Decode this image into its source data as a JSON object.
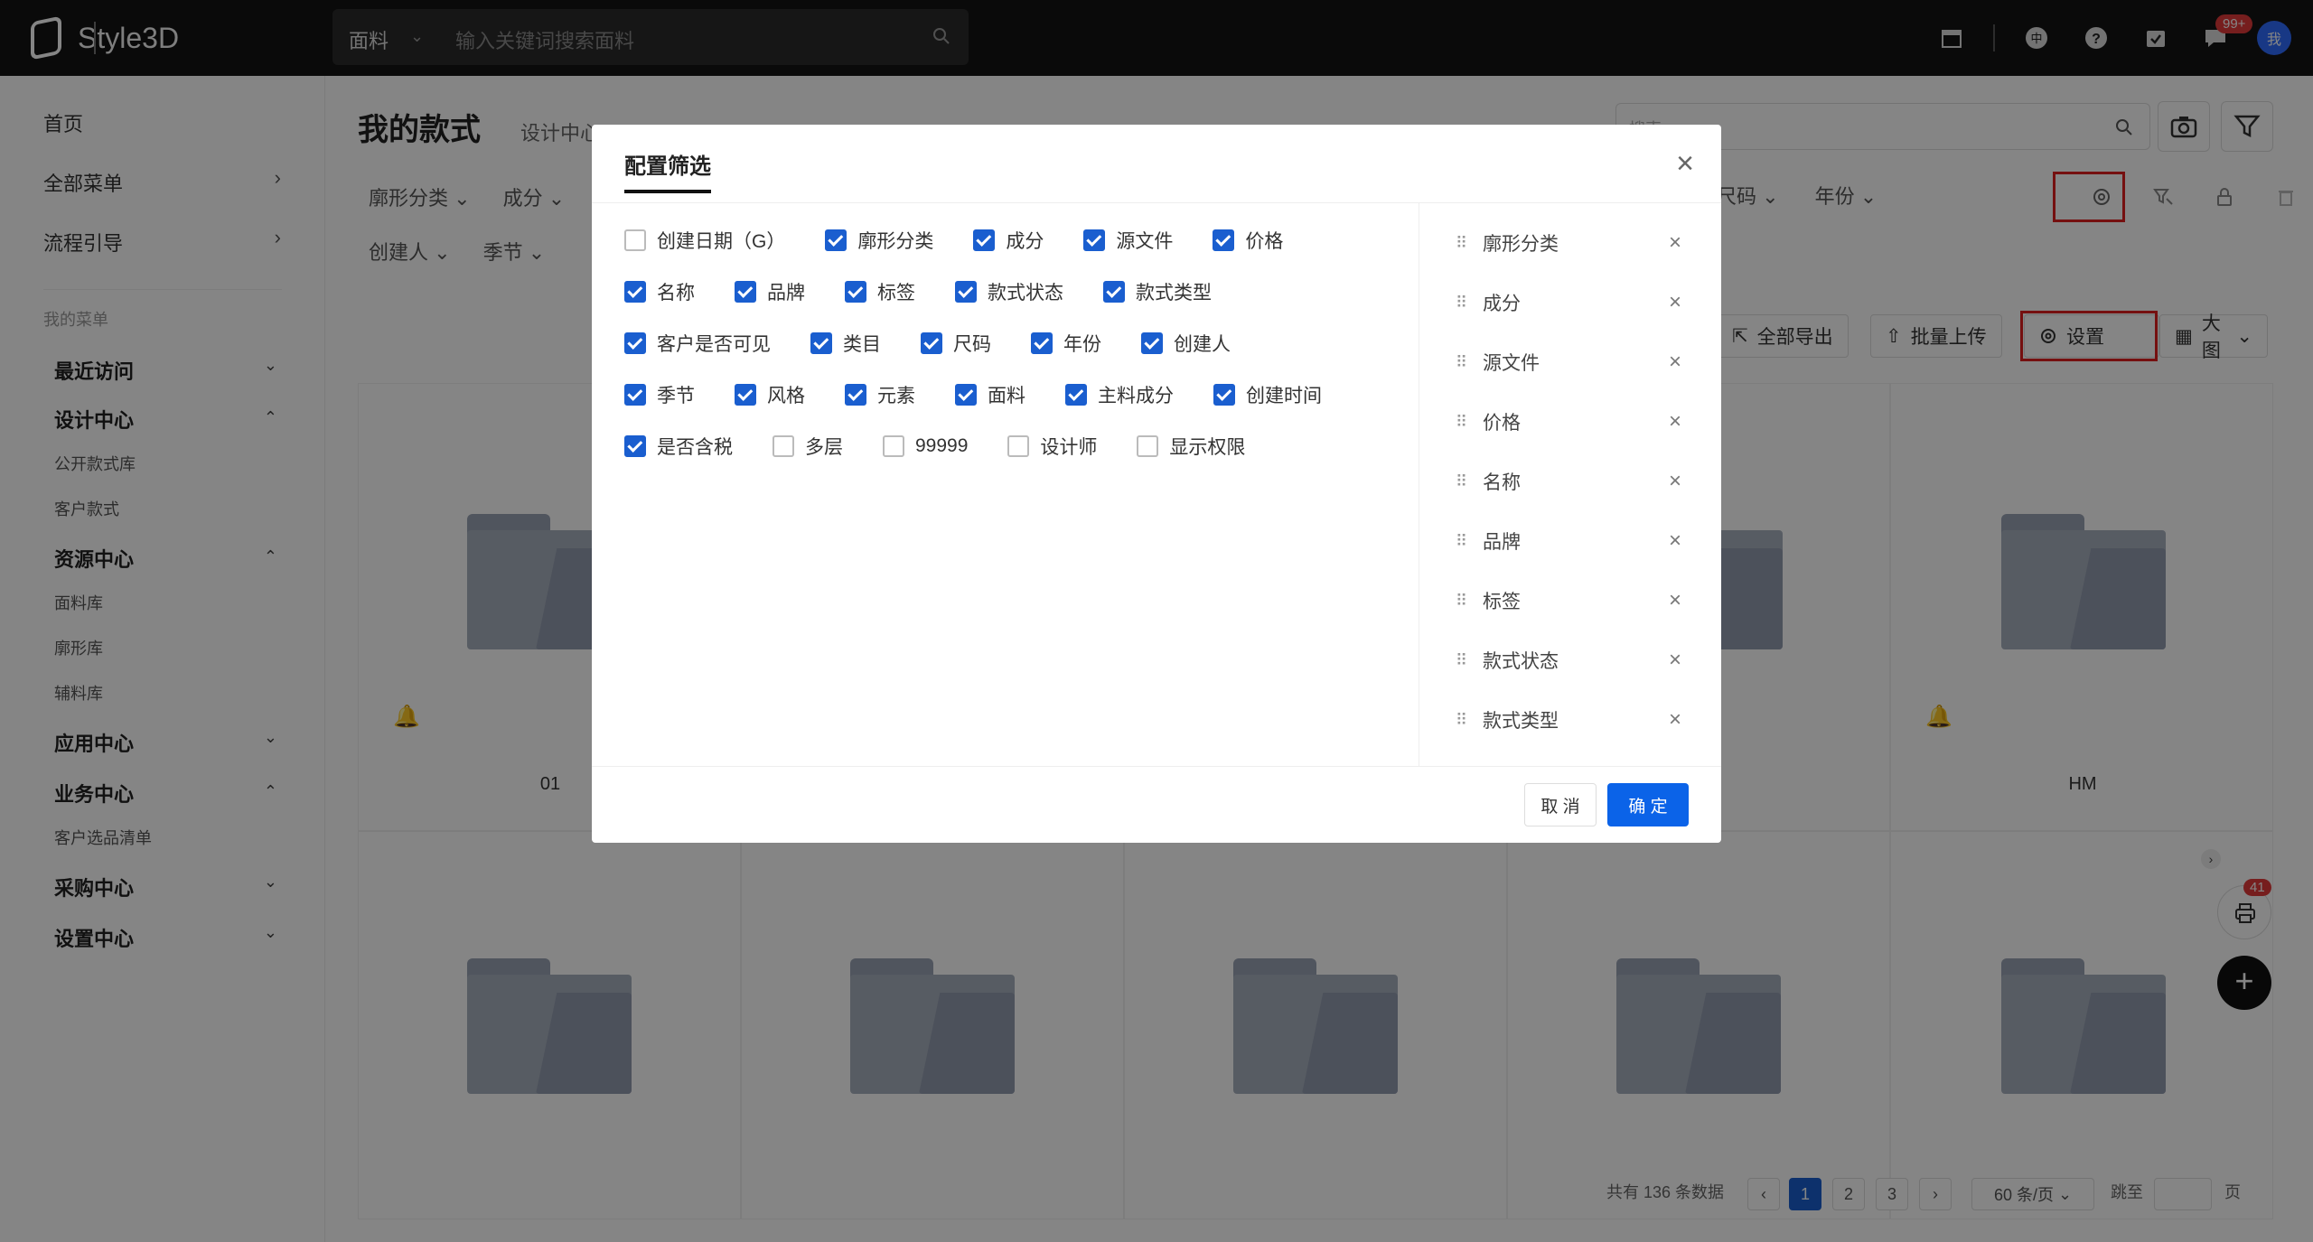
{
  "app": {
    "name": "Style3D"
  },
  "topbar": {
    "search_category": "面料",
    "search_placeholder": "输入关键词搜索面料",
    "message_badge": "99+",
    "avatar_text": "我"
  },
  "sidebar": {
    "top_items": [
      {
        "label": "首页"
      },
      {
        "label": "全部菜单"
      },
      {
        "label": "流程引导"
      }
    ],
    "caption": "我的菜单",
    "groups": [
      {
        "label": "最近访问"
      },
      {
        "label": "设计中心",
        "children": [
          "公开款式库",
          "客户款式"
        ]
      },
      {
        "label": "资源中心",
        "children": [
          "面料库",
          "廓形库",
          "辅料库"
        ]
      },
      {
        "label": "应用中心"
      },
      {
        "label": "业务中心",
        "children": [
          "客户选品清单"
        ]
      },
      {
        "label": "采购中心"
      },
      {
        "label": "设置中心"
      }
    ]
  },
  "main": {
    "title": "我的款式",
    "breadcrumb": "设计中心",
    "filters_row1": [
      "廓形分类",
      "成分"
    ],
    "filters_row2": [
      "创建人",
      "季节"
    ],
    "right_filters": [
      "尺码",
      "年份"
    ],
    "search_placeholder": "搜索",
    "toolbar": {
      "export_all": "全部导出",
      "batch_upload": "批量上传",
      "settings": "设置",
      "view_mode": "大图"
    },
    "cells": [
      {
        "label": "01",
        "bell": true
      },
      {
        "label": "HM",
        "bell": true
      }
    ],
    "pagination": {
      "total_text": "共有 136 条数据",
      "pages": [
        "1",
        "2",
        "3"
      ],
      "current": "1",
      "page_size": "60 条/页",
      "jump_label": "跳至",
      "page_unit": "页"
    },
    "print_badge": "41"
  },
  "modal": {
    "title": "配置筛选",
    "options": [
      [
        {
          "label": "创建日期（G）",
          "checked": false
        },
        {
          "label": "廓形分类",
          "checked": true
        },
        {
          "label": "成分",
          "checked": true
        },
        {
          "label": "源文件",
          "checked": true
        },
        {
          "label": "价格",
          "checked": true
        }
      ],
      [
        {
          "label": "名称",
          "checked": true
        },
        {
          "label": "品牌",
          "checked": true
        },
        {
          "label": "标签",
          "checked": true
        },
        {
          "label": "款式状态",
          "checked": true
        },
        {
          "label": "款式类型",
          "checked": true
        }
      ],
      [
        {
          "label": "客户是否可见",
          "checked": true
        },
        {
          "label": "类目",
          "checked": true
        },
        {
          "label": "尺码",
          "checked": true
        },
        {
          "label": "年份",
          "checked": true
        },
        {
          "label": "创建人",
          "checked": true
        }
      ],
      [
        {
          "label": "季节",
          "checked": true
        },
        {
          "label": "风格",
          "checked": true
        },
        {
          "label": "元素",
          "checked": true
        },
        {
          "label": "面料",
          "checked": true
        },
        {
          "label": "主料成分",
          "checked": true
        },
        {
          "label": "创建时间",
          "checked": true
        }
      ],
      [
        {
          "label": "是否含税",
          "checked": true
        },
        {
          "label": "多层",
          "checked": false
        },
        {
          "label": "99999",
          "checked": false
        },
        {
          "label": "设计师",
          "checked": false
        },
        {
          "label": "显示权限",
          "checked": false
        }
      ]
    ],
    "selected": [
      "廓形分类",
      "成分",
      "源文件",
      "价格",
      "名称",
      "品牌",
      "标签",
      "款式状态",
      "款式类型"
    ],
    "cancel_label": "取 消",
    "ok_label": "确 定"
  }
}
